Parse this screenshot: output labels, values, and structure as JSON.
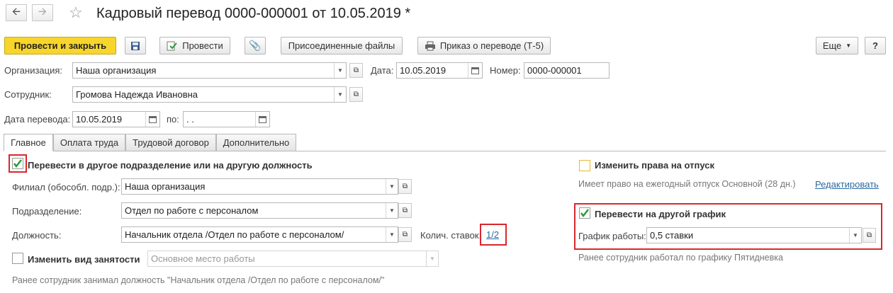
{
  "window": {
    "title": "Кадровый перевод 0000-000001 от 10.05.2019 *"
  },
  "toolbar": {
    "post_and_close": "Провести и закрыть",
    "post": "Провести",
    "attached_files": "Присоединенные файлы",
    "print_order": "Приказ о переводе (Т-5)",
    "more": "Еще",
    "help": "?"
  },
  "header": {
    "org_label": "Организация:",
    "org_value": "Наша организация",
    "date_label": "Дата:",
    "date_value": "10.05.2019",
    "number_label": "Номер:",
    "number_value": "0000-000001",
    "employee_label": "Сотрудник:",
    "employee_value": "Громова Надежда Ивановна",
    "transfer_date_label": "Дата перевода:",
    "transfer_date_value": "10.05.2019",
    "to_label": "по:",
    "to_value": " .  ."
  },
  "tabs": [
    {
      "label": "Главное",
      "active": true
    },
    {
      "label": "Оплата труда",
      "active": false
    },
    {
      "label": "Трудовой договор",
      "active": false
    },
    {
      "label": "Дополнительно",
      "active": false
    }
  ],
  "main": {
    "transfer_dept_label": "Перевести в другое подразделение или на другую должность",
    "transfer_dept_checked": true,
    "branch_label": "Филиал (обособл. подр.):",
    "branch_value": "Наша организация",
    "dept_label": "Подразделение:",
    "dept_value": "Отдел по работе с персоналом",
    "position_label": "Должность:",
    "position_value": "Начальник отдела /Отдел по работе с персоналом/",
    "rate_label": "Колич. ставок:",
    "rate_value": "1/2",
    "change_employment_label": "Изменить вид занятости",
    "change_employment_checked": false,
    "employment_value": "Основное место работы",
    "previous_position_note": "Ранее сотрудник занимал должность \"Начальник отдела /Отдел по работе с персоналом/\""
  },
  "right": {
    "vacation_label": "Изменить права на отпуск",
    "vacation_checked": false,
    "vacation_note": "Имеет право на ежегодный отпуск Основной (28 дн.)",
    "edit_link": "Редактировать",
    "schedule_label": "Перевести на другой график",
    "schedule_checked": true,
    "schedule_field_label": "График работы:",
    "schedule_value": "0,5 ставки",
    "schedule_note": "Ранее сотрудник работал по графику Пятидневка"
  },
  "colors": {
    "primary_button": "#f7d52b",
    "highlight": "#d9272e",
    "link": "#2b6aa0",
    "check": "#2a9b3a"
  }
}
